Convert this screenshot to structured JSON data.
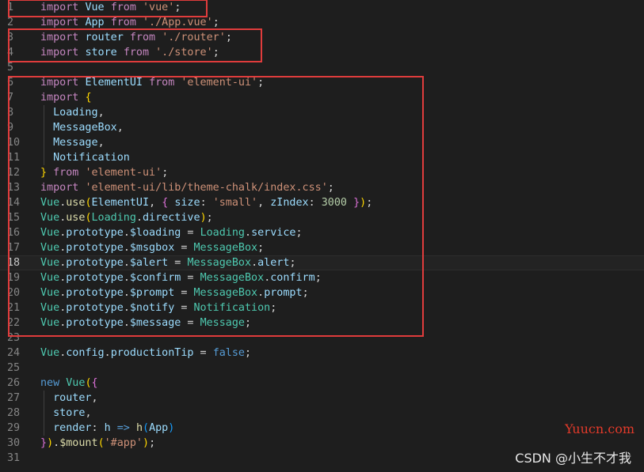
{
  "editor": {
    "current_line": 18,
    "lines": [
      {
        "n": "1",
        "tokens": [
          {
            "t": "import",
            "c": "kw"
          },
          {
            "t": " "
          },
          {
            "t": "Vue",
            "c": "id"
          },
          {
            "t": " "
          },
          {
            "t": "from",
            "c": "kw"
          },
          {
            "t": " "
          },
          {
            "t": "'vue'",
            "c": "str"
          },
          {
            "t": ";",
            "c": "pu"
          }
        ]
      },
      {
        "n": "2",
        "tokens": [
          {
            "t": "import",
            "c": "kw"
          },
          {
            "t": " "
          },
          {
            "t": "App",
            "c": "id"
          },
          {
            "t": " "
          },
          {
            "t": "from",
            "c": "kw"
          },
          {
            "t": " "
          },
          {
            "t": "'./App.vue'",
            "c": "str"
          },
          {
            "t": ";",
            "c": "pu"
          }
        ]
      },
      {
        "n": "3",
        "tokens": [
          {
            "t": "import",
            "c": "kw"
          },
          {
            "t": " "
          },
          {
            "t": "router",
            "c": "id"
          },
          {
            "t": " "
          },
          {
            "t": "from",
            "c": "kw"
          },
          {
            "t": " "
          },
          {
            "t": "'./router'",
            "c": "str"
          },
          {
            "t": ";",
            "c": "pu"
          }
        ]
      },
      {
        "n": "4",
        "tokens": [
          {
            "t": "import",
            "c": "kw"
          },
          {
            "t": " "
          },
          {
            "t": "store",
            "c": "id"
          },
          {
            "t": " "
          },
          {
            "t": "from",
            "c": "kw"
          },
          {
            "t": " "
          },
          {
            "t": "'./store'",
            "c": "str"
          },
          {
            "t": ";",
            "c": "pu"
          }
        ]
      },
      {
        "n": "5",
        "tokens": []
      },
      {
        "n": "6",
        "tokens": [
          {
            "t": "import",
            "c": "kw"
          },
          {
            "t": " "
          },
          {
            "t": "ElementUI",
            "c": "id"
          },
          {
            "t": " "
          },
          {
            "t": "from",
            "c": "kw"
          },
          {
            "t": " "
          },
          {
            "t": "'element-ui'",
            "c": "str"
          },
          {
            "t": ";",
            "c": "pu"
          }
        ]
      },
      {
        "n": "7",
        "tokens": [
          {
            "t": "import",
            "c": "kw"
          },
          {
            "t": " "
          },
          {
            "t": "{",
            "c": "br1"
          }
        ]
      },
      {
        "n": "8",
        "tokens": [
          {
            "t": "  "
          },
          {
            "t": "Loading",
            "c": "id"
          },
          {
            "t": ",",
            "c": "pu"
          }
        ]
      },
      {
        "n": "9",
        "tokens": [
          {
            "t": "  "
          },
          {
            "t": "MessageBox",
            "c": "id"
          },
          {
            "t": ",",
            "c": "pu"
          }
        ]
      },
      {
        "n": "10",
        "tokens": [
          {
            "t": "  "
          },
          {
            "t": "Message",
            "c": "id"
          },
          {
            "t": ",",
            "c": "pu"
          }
        ]
      },
      {
        "n": "11",
        "tokens": [
          {
            "t": "  "
          },
          {
            "t": "Notification",
            "c": "id"
          }
        ]
      },
      {
        "n": "12",
        "tokens": [
          {
            "t": "}",
            "c": "br1"
          },
          {
            "t": " "
          },
          {
            "t": "from",
            "c": "kw"
          },
          {
            "t": " "
          },
          {
            "t": "'element-ui'",
            "c": "str"
          },
          {
            "t": ";",
            "c": "pu"
          }
        ]
      },
      {
        "n": "13",
        "tokens": [
          {
            "t": "import",
            "c": "kw"
          },
          {
            "t": " "
          },
          {
            "t": "'element-ui/lib/theme-chalk/index.css'",
            "c": "str"
          },
          {
            "t": ";",
            "c": "pu"
          }
        ]
      },
      {
        "n": "14",
        "tokens": [
          {
            "t": "Vue",
            "c": "cl"
          },
          {
            "t": ".",
            "c": "pu"
          },
          {
            "t": "use",
            "c": "fn"
          },
          {
            "t": "(",
            "c": "br1"
          },
          {
            "t": "ElementUI",
            "c": "id"
          },
          {
            "t": ", ",
            "c": "pu"
          },
          {
            "t": "{",
            "c": "br2"
          },
          {
            "t": " "
          },
          {
            "t": "size",
            "c": "id"
          },
          {
            "t": ": ",
            "c": "pu"
          },
          {
            "t": "'small'",
            "c": "str"
          },
          {
            "t": ", ",
            "c": "pu"
          },
          {
            "t": "zIndex",
            "c": "id"
          },
          {
            "t": ": ",
            "c": "pu"
          },
          {
            "t": "3000",
            "c": "num"
          },
          {
            "t": " "
          },
          {
            "t": "}",
            "c": "br2"
          },
          {
            "t": ")",
            "c": "br1"
          },
          {
            "t": ";",
            "c": "pu"
          }
        ]
      },
      {
        "n": "15",
        "tokens": [
          {
            "t": "Vue",
            "c": "cl"
          },
          {
            "t": ".",
            "c": "pu"
          },
          {
            "t": "use",
            "c": "fn"
          },
          {
            "t": "(",
            "c": "br1"
          },
          {
            "t": "Loading",
            "c": "cl"
          },
          {
            "t": ".",
            "c": "pu"
          },
          {
            "t": "directive",
            "c": "id"
          },
          {
            "t": ")",
            "c": "br1"
          },
          {
            "t": ";",
            "c": "pu"
          }
        ]
      },
      {
        "n": "16",
        "tokens": [
          {
            "t": "Vue",
            "c": "cl"
          },
          {
            "t": ".",
            "c": "pu"
          },
          {
            "t": "prototype",
            "c": "id"
          },
          {
            "t": ".",
            "c": "pu"
          },
          {
            "t": "$loading",
            "c": "id"
          },
          {
            "t": " = ",
            "c": "pu"
          },
          {
            "t": "Loading",
            "c": "cl"
          },
          {
            "t": ".",
            "c": "pu"
          },
          {
            "t": "service",
            "c": "id"
          },
          {
            "t": ";",
            "c": "pu"
          }
        ]
      },
      {
        "n": "17",
        "tokens": [
          {
            "t": "Vue",
            "c": "cl"
          },
          {
            "t": ".",
            "c": "pu"
          },
          {
            "t": "prototype",
            "c": "id"
          },
          {
            "t": ".",
            "c": "pu"
          },
          {
            "t": "$msgbox",
            "c": "id"
          },
          {
            "t": " = ",
            "c": "pu"
          },
          {
            "t": "MessageBox",
            "c": "cl"
          },
          {
            "t": ";",
            "c": "pu"
          }
        ]
      },
      {
        "n": "18",
        "tokens": [
          {
            "t": "Vue",
            "c": "cl"
          },
          {
            "t": ".",
            "c": "pu"
          },
          {
            "t": "prototype",
            "c": "id"
          },
          {
            "t": ".",
            "c": "pu"
          },
          {
            "t": "$alert",
            "c": "id"
          },
          {
            "t": " = ",
            "c": "pu"
          },
          {
            "t": "MessageBox",
            "c": "cl"
          },
          {
            "t": ".",
            "c": "pu"
          },
          {
            "t": "alert",
            "c": "id"
          },
          {
            "t": ";",
            "c": "pu"
          }
        ]
      },
      {
        "n": "19",
        "tokens": [
          {
            "t": "Vue",
            "c": "cl"
          },
          {
            "t": ".",
            "c": "pu"
          },
          {
            "t": "prototype",
            "c": "id"
          },
          {
            "t": ".",
            "c": "pu"
          },
          {
            "t": "$confirm",
            "c": "id"
          },
          {
            "t": " = ",
            "c": "pu"
          },
          {
            "t": "MessageBox",
            "c": "cl"
          },
          {
            "t": ".",
            "c": "pu"
          },
          {
            "t": "confirm",
            "c": "id"
          },
          {
            "t": ";",
            "c": "pu"
          }
        ]
      },
      {
        "n": "20",
        "tokens": [
          {
            "t": "Vue",
            "c": "cl"
          },
          {
            "t": ".",
            "c": "pu"
          },
          {
            "t": "prototype",
            "c": "id"
          },
          {
            "t": ".",
            "c": "pu"
          },
          {
            "t": "$prompt",
            "c": "id"
          },
          {
            "t": " = ",
            "c": "pu"
          },
          {
            "t": "MessageBox",
            "c": "cl"
          },
          {
            "t": ".",
            "c": "pu"
          },
          {
            "t": "prompt",
            "c": "id"
          },
          {
            "t": ";",
            "c": "pu"
          }
        ]
      },
      {
        "n": "21",
        "tokens": [
          {
            "t": "Vue",
            "c": "cl"
          },
          {
            "t": ".",
            "c": "pu"
          },
          {
            "t": "prototype",
            "c": "id"
          },
          {
            "t": ".",
            "c": "pu"
          },
          {
            "t": "$notify",
            "c": "id"
          },
          {
            "t": " = ",
            "c": "pu"
          },
          {
            "t": "Notification",
            "c": "cl"
          },
          {
            "t": ";",
            "c": "pu"
          }
        ]
      },
      {
        "n": "22",
        "tokens": [
          {
            "t": "Vue",
            "c": "cl"
          },
          {
            "t": ".",
            "c": "pu"
          },
          {
            "t": "prototype",
            "c": "id"
          },
          {
            "t": ".",
            "c": "pu"
          },
          {
            "t": "$message",
            "c": "id"
          },
          {
            "t": " = ",
            "c": "pu"
          },
          {
            "t": "Message",
            "c": "cl"
          },
          {
            "t": ";",
            "c": "pu"
          }
        ]
      },
      {
        "n": "23",
        "tokens": []
      },
      {
        "n": "24",
        "tokens": [
          {
            "t": "Vue",
            "c": "cl"
          },
          {
            "t": ".",
            "c": "pu"
          },
          {
            "t": "config",
            "c": "id"
          },
          {
            "t": ".",
            "c": "pu"
          },
          {
            "t": "productionTip",
            "c": "id"
          },
          {
            "t": " = ",
            "c": "pu"
          },
          {
            "t": "false",
            "c": "kw2"
          },
          {
            "t": ";",
            "c": "pu"
          }
        ]
      },
      {
        "n": "25",
        "tokens": []
      },
      {
        "n": "26",
        "tokens": [
          {
            "t": "new",
            "c": "kw2"
          },
          {
            "t": " "
          },
          {
            "t": "Vue",
            "c": "cl"
          },
          {
            "t": "(",
            "c": "br1"
          },
          {
            "t": "{",
            "c": "br2"
          }
        ]
      },
      {
        "n": "27",
        "tokens": [
          {
            "t": "  "
          },
          {
            "t": "router",
            "c": "id"
          },
          {
            "t": ",",
            "c": "pu"
          }
        ]
      },
      {
        "n": "28",
        "tokens": [
          {
            "t": "  "
          },
          {
            "t": "store",
            "c": "id"
          },
          {
            "t": ",",
            "c": "pu"
          }
        ]
      },
      {
        "n": "29",
        "tokens": [
          {
            "t": "  "
          },
          {
            "t": "render",
            "c": "id"
          },
          {
            "t": ": ",
            "c": "pu"
          },
          {
            "t": "h",
            "c": "id"
          },
          {
            "t": " "
          },
          {
            "t": "=>",
            "c": "kw2"
          },
          {
            "t": " "
          },
          {
            "t": "h",
            "c": "fn"
          },
          {
            "t": "(",
            "c": "br3"
          },
          {
            "t": "App",
            "c": "id"
          },
          {
            "t": ")",
            "c": "br3"
          }
        ]
      },
      {
        "n": "30",
        "tokens": [
          {
            "t": "}",
            "c": "br2"
          },
          {
            "t": ")",
            "c": "br1"
          },
          {
            "t": ".",
            "c": "pu"
          },
          {
            "t": "$mount",
            "c": "fn"
          },
          {
            "t": "(",
            "c": "br1"
          },
          {
            "t": "'#app'",
            "c": "str"
          },
          {
            "t": ")",
            "c": "br1"
          },
          {
            "t": ";",
            "c": "pu"
          }
        ]
      },
      {
        "n": "31",
        "tokens": []
      }
    ]
  },
  "watermarks": {
    "site": "Yuucn.com",
    "author": "CSDN @小生不才我"
  },
  "colors": {
    "background": "#1e1e1e",
    "annotation_box": "#e03c3c",
    "keyword": "#c586c0",
    "string": "#ce9178",
    "variable": "#9cdcfe",
    "class": "#4ec9b0"
  }
}
